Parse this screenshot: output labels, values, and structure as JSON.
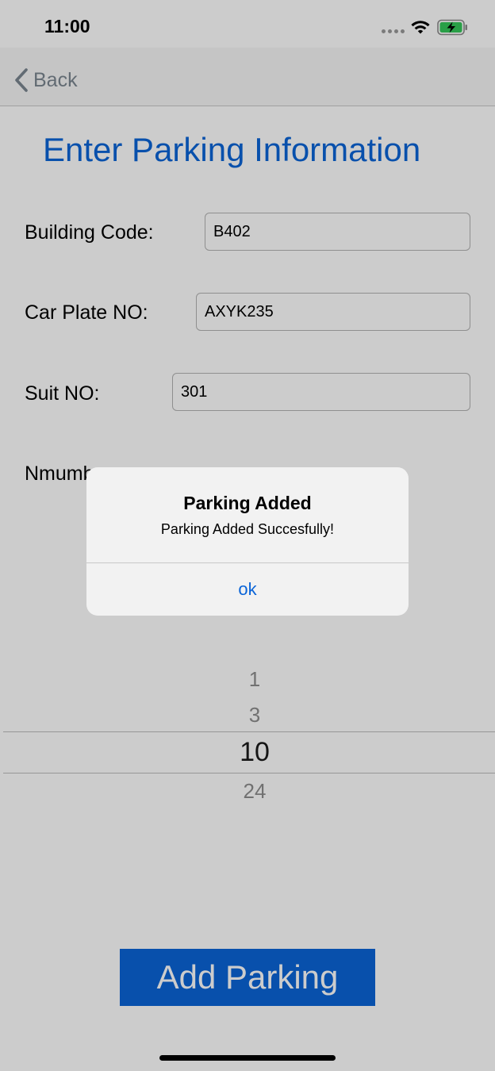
{
  "status_bar": {
    "time": "11:00"
  },
  "nav": {
    "back_label": "Back"
  },
  "page": {
    "title": "Enter Parking Information"
  },
  "form": {
    "building_code": {
      "label": "Building Code:",
      "value": "B402"
    },
    "car_plate": {
      "label": "Car Plate NO:",
      "value": "AXYK235"
    },
    "suit_no": {
      "label": "Suit NO:",
      "value": "301"
    },
    "hours_label_visible": "Nmumb"
  },
  "picker": {
    "items": [
      "1",
      "3",
      "10",
      "24"
    ],
    "selected": "10"
  },
  "actions": {
    "add_parking": "Add Parking"
  },
  "alert": {
    "title": "Parking Added",
    "message": "Parking Added Succesfully!",
    "ok_label": "ok"
  },
  "colors": {
    "accent": "#0a64d8",
    "background": "#ffffff",
    "dim": "rgba(0,0,0,0.2)"
  },
  "icons": [
    "chevron-left-icon",
    "wifi-icon",
    "battery-charging-icon",
    "signal-icon"
  ]
}
